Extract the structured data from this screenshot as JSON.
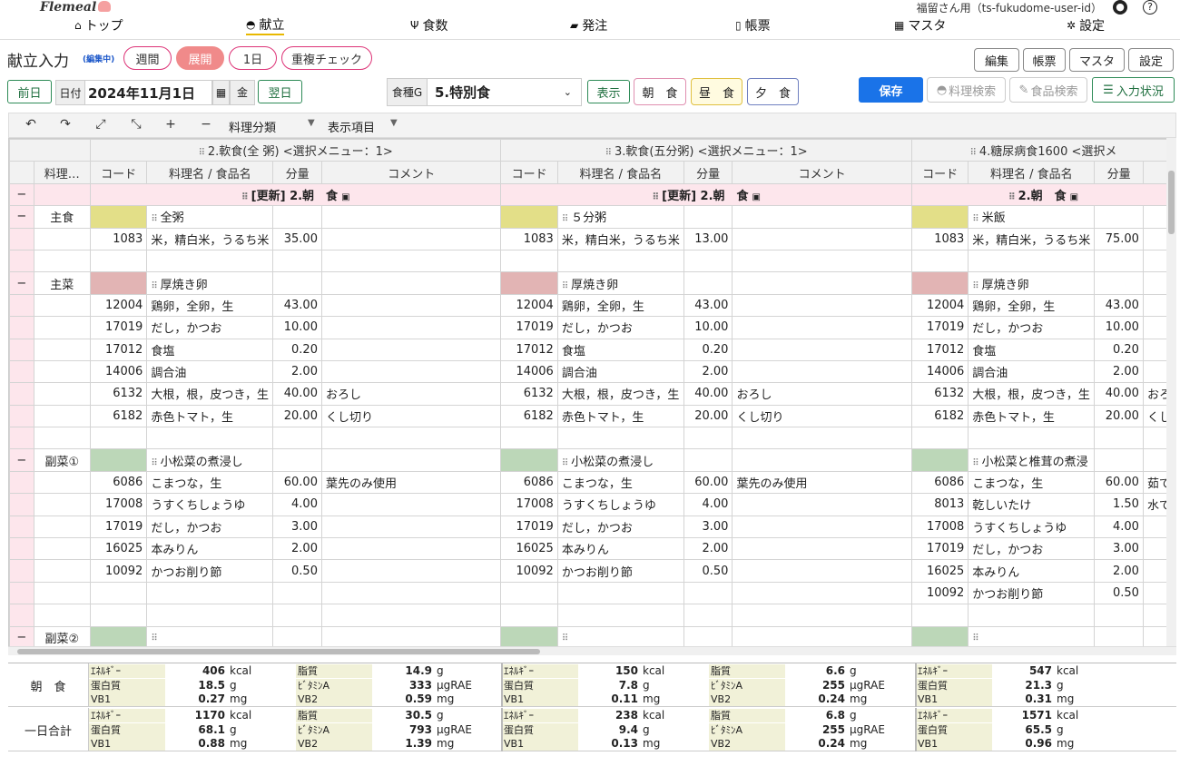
{
  "app": {
    "logo": "Flemeal",
    "user": "福留さん用（ts-fukudome-user-id）"
  },
  "nav": [
    {
      "label": "トップ",
      "icon": "home-icon"
    },
    {
      "label": "献立",
      "icon": "menu-bowl-icon"
    },
    {
      "label": "食数",
      "icon": "utensils-icon"
    },
    {
      "label": "発注",
      "icon": "truck-icon"
    },
    {
      "label": "帳票",
      "icon": "file-icon"
    },
    {
      "label": "マスタ",
      "icon": "table-icon"
    },
    {
      "label": "設定",
      "icon": "gears-icon"
    }
  ],
  "page": {
    "title": "献立入力",
    "status": "(編集中)"
  },
  "view_pills": [
    "週間",
    "展開",
    "1日",
    "重複チェック"
  ],
  "right_buttons": [
    "編集",
    "帳票",
    "マスタ",
    "設定"
  ],
  "date_bar": {
    "prev": "前日",
    "date_label": "日付",
    "date": "2024年11月1日",
    "weekday": "金",
    "next": "翌日",
    "group_label": "食種G",
    "group_value": "5.特別食",
    "show": "表示",
    "meals": [
      "朝　食",
      "昼　食",
      "夕　食"
    ]
  },
  "action_buttons": {
    "save": "保存",
    "dish_search": "料理検索",
    "food_search": "食品検索",
    "input_status": "入力状況"
  },
  "toolbar": {
    "dish_category": "料理分類",
    "display_items": "表示項目"
  },
  "columns": {
    "category": "料理…",
    "code": "コード",
    "name": "料理名 / 食品名",
    "amount": "分量",
    "comment": "コメント"
  },
  "diets": [
    {
      "title": "2.軟食(全 粥) <選択メニュー：1>",
      "meal": "[更新] 2.朝　食"
    },
    {
      "title": "3.軟食(五分粥) <選択メニュー：1>",
      "meal": "[更新] 2.朝　食"
    },
    {
      "title": "4.糖尿病食1600 <選択メ",
      "meal": "2.朝　食"
    }
  ],
  "sections": [
    {
      "category": "主食",
      "dishes": [
        "全粥",
        "５分粥",
        "米飯"
      ],
      "items": [
        [
          {
            "code": "1083",
            "name": "米，精白米，うるち米",
            "amount": "35.00",
            "comment": ""
          },
          {
            "code": "1083",
            "name": "米，精白米，うるち米",
            "amount": "13.00",
            "comment": ""
          },
          {
            "code": "1083",
            "name": "米，精白米，うるち米",
            "amount": "75.00",
            "comment": ""
          }
        ]
      ],
      "blank_rows": 1
    },
    {
      "category": "主菜",
      "dishes": [
        "厚焼き卵",
        "厚焼き卵",
        "厚焼き卵"
      ],
      "items": [
        [
          {
            "code": "12004",
            "name": "鶏卵，全卵，生",
            "amount": "43.00",
            "comment": ""
          },
          {
            "code": "12004",
            "name": "鶏卵，全卵，生",
            "amount": "43.00",
            "comment": ""
          },
          {
            "code": "12004",
            "name": "鶏卵，全卵，生",
            "amount": "43.00",
            "comment": ""
          }
        ],
        [
          {
            "code": "17019",
            "name": "だし，かつお",
            "amount": "10.00",
            "comment": ""
          },
          {
            "code": "17019",
            "name": "だし，かつお",
            "amount": "10.00",
            "comment": ""
          },
          {
            "code": "17019",
            "name": "だし，かつお",
            "amount": "10.00",
            "comment": ""
          }
        ],
        [
          {
            "code": "17012",
            "name": "食塩",
            "amount": "0.20",
            "comment": ""
          },
          {
            "code": "17012",
            "name": "食塩",
            "amount": "0.20",
            "comment": ""
          },
          {
            "code": "17012",
            "name": "食塩",
            "amount": "0.20",
            "comment": ""
          }
        ],
        [
          {
            "code": "14006",
            "name": "調合油",
            "amount": "2.00",
            "comment": ""
          },
          {
            "code": "14006",
            "name": "調合油",
            "amount": "2.00",
            "comment": ""
          },
          {
            "code": "14006",
            "name": "調合油",
            "amount": "2.00",
            "comment": ""
          }
        ],
        [
          {
            "code": "6132",
            "name": "大根，根，皮つき，生",
            "amount": "40.00",
            "comment": "おろし"
          },
          {
            "code": "6132",
            "name": "大根，根，皮つき，生",
            "amount": "40.00",
            "comment": "おろし"
          },
          {
            "code": "6132",
            "name": "大根，根，皮つき，生",
            "amount": "40.00",
            "comment": "おろ"
          }
        ],
        [
          {
            "code": "6182",
            "name": "赤色トマト，生",
            "amount": "20.00",
            "comment": "くし切り"
          },
          {
            "code": "6182",
            "name": "赤色トマト，生",
            "amount": "20.00",
            "comment": "くし切り"
          },
          {
            "code": "6182",
            "name": "赤色トマト，生",
            "amount": "20.00",
            "comment": "くし"
          }
        ]
      ],
      "blank_rows": 1
    },
    {
      "category": "副菜①",
      "dishes": [
        "小松菜の煮浸し",
        "小松菜の煮浸し",
        "小松菜と椎茸の煮浸"
      ],
      "items": [
        [
          {
            "code": "6086",
            "name": "こまつな，生",
            "amount": "60.00",
            "comment": "葉先のみ使用"
          },
          {
            "code": "6086",
            "name": "こまつな，生",
            "amount": "60.00",
            "comment": "葉先のみ使用"
          },
          {
            "code": "6086",
            "name": "こまつな，生",
            "amount": "60.00",
            "comment": "茹で"
          }
        ],
        [
          {
            "code": "17008",
            "name": "うすくちしょうゆ",
            "amount": "4.00",
            "comment": ""
          },
          {
            "code": "17008",
            "name": "うすくちしょうゆ",
            "amount": "4.00",
            "comment": ""
          },
          {
            "code": "8013",
            "name": "乾しいたけ",
            "amount": "1.50",
            "comment": "水で"
          }
        ],
        [
          {
            "code": "17019",
            "name": "だし，かつお",
            "amount": "3.00",
            "comment": ""
          },
          {
            "code": "17019",
            "name": "だし，かつお",
            "amount": "3.00",
            "comment": ""
          },
          {
            "code": "17008",
            "name": "うすくちしょうゆ",
            "amount": "4.00",
            "comment": ""
          }
        ],
        [
          {
            "code": "16025",
            "name": "本みりん",
            "amount": "2.00",
            "comment": ""
          },
          {
            "code": "16025",
            "name": "本みりん",
            "amount": "2.00",
            "comment": ""
          },
          {
            "code": "17019",
            "name": "だし，かつお",
            "amount": "3.00",
            "comment": ""
          }
        ],
        [
          {
            "code": "10092",
            "name": "かつお削り節",
            "amount": "0.50",
            "comment": ""
          },
          {
            "code": "10092",
            "name": "かつお削り節",
            "amount": "0.50",
            "comment": ""
          },
          {
            "code": "16025",
            "name": "本みりん",
            "amount": "2.00",
            "comment": ""
          }
        ],
        [
          {
            "code": "",
            "name": "",
            "amount": "",
            "comment": ""
          },
          {
            "code": "",
            "name": "",
            "amount": "",
            "comment": ""
          },
          {
            "code": "10092",
            "name": "かつお削り節",
            "amount": "0.50",
            "comment": ""
          }
        ]
      ],
      "blank_rows": 1
    },
    {
      "category": "副菜②",
      "dishes": [
        "",
        "",
        ""
      ],
      "items": [],
      "blank_rows": 0
    }
  ],
  "summary": {
    "labels": {
      "energy": "ｴﾈﾙｷﾞｰ",
      "protein": "蛋白質",
      "vb1": "VB1",
      "fat": "脂質",
      "vita": "ﾋﾞﾀﾐﾝA",
      "vb2": "VB2"
    },
    "units": {
      "energy": "kcal",
      "protein": "g",
      "vb1": "mg",
      "fat": "g",
      "vita": "µgRAE",
      "vb2": "mg"
    },
    "rows": [
      {
        "label": "朝　食",
        "cols": [
          {
            "energy": "406",
            "protein": "18.5",
            "vb1": "0.27",
            "fat": "14.9",
            "vita": "333",
            "vb2": "0.59"
          },
          {
            "energy": "150",
            "protein": "7.8",
            "vb1": "0.11",
            "fat": "6.6",
            "vita": "255",
            "vb2": "0.24"
          },
          {
            "energy": "547",
            "protein": "21.3",
            "vb1": "0.31"
          }
        ]
      },
      {
        "label": "一日合計",
        "cols": [
          {
            "energy": "1170",
            "protein": "68.1",
            "vb1": "0.88",
            "fat": "30.5",
            "vita": "793",
            "vb2": "1.39"
          },
          {
            "energy": "238",
            "protein": "9.4",
            "vb1": "0.13",
            "fat": "6.8",
            "vita": "255",
            "vb2": "0.24"
          },
          {
            "energy": "1571",
            "protein": "65.5",
            "vb1": "0.96"
          }
        ]
      }
    ]
  }
}
